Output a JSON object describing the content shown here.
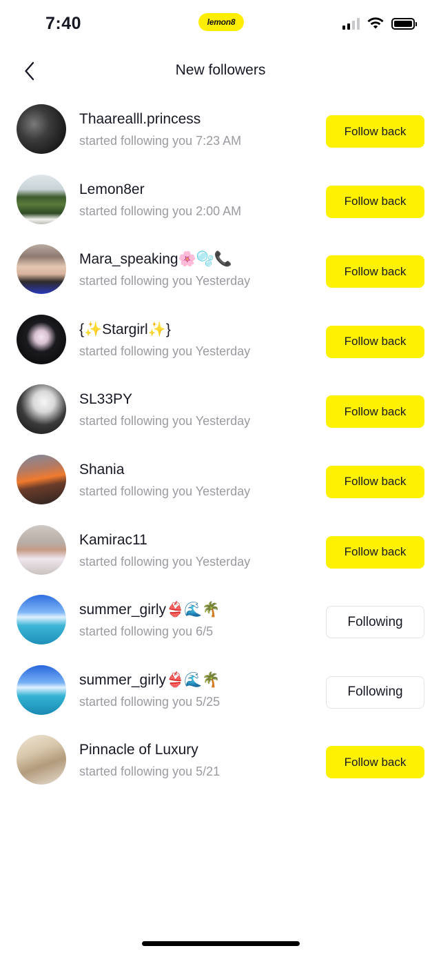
{
  "status_bar": {
    "time": "7:40",
    "app_badge": "lemon8",
    "icons": [
      "cellular-signal-icon",
      "wifi-icon",
      "battery-icon"
    ]
  },
  "header": {
    "back_icon": "chevron-left-icon",
    "title": "New followers"
  },
  "followers": [
    {
      "name": "Thaarealll.princess",
      "activity": "started following you 7:23 AM",
      "button": "Follow back",
      "button_style": "yellow"
    },
    {
      "name": "Lemon8er",
      "activity": "started following you 2:00 AM",
      "button": "Follow back",
      "button_style": "yellow"
    },
    {
      "name": "Mara_speaking🌸🫧📞",
      "activity": "started following you Yesterday",
      "button": "Follow back",
      "button_style": "yellow"
    },
    {
      "name": "{✨Stargirl✨}",
      "activity": "started following you Yesterday",
      "button": "Follow back",
      "button_style": "yellow"
    },
    {
      "name": "SL33PY",
      "activity": "started following you Yesterday",
      "button": "Follow back",
      "button_style": "yellow"
    },
    {
      "name": "Shania",
      "activity": "started following you Yesterday",
      "button": "Follow back",
      "button_style": "yellow"
    },
    {
      "name": "Kamirac11",
      "activity": "started following you Yesterday",
      "button": "Follow back",
      "button_style": "yellow"
    },
    {
      "name": "summer_girly👙🌊🌴",
      "activity": "started following you 6/5",
      "button": "Following",
      "button_style": "outline"
    },
    {
      "name": "summer_girly👙🌊🌴",
      "activity": "started following you 5/25",
      "button": "Following",
      "button_style": "outline"
    },
    {
      "name": "Pinnacle of Luxury",
      "activity": "started following you 5/21",
      "button": "Follow back",
      "button_style": "yellow"
    }
  ],
  "colors": {
    "accent_yellow": "#fff200",
    "text_primary": "#161823",
    "text_secondary": "#9a9ba1",
    "outline_border": "#e3e3e6"
  }
}
